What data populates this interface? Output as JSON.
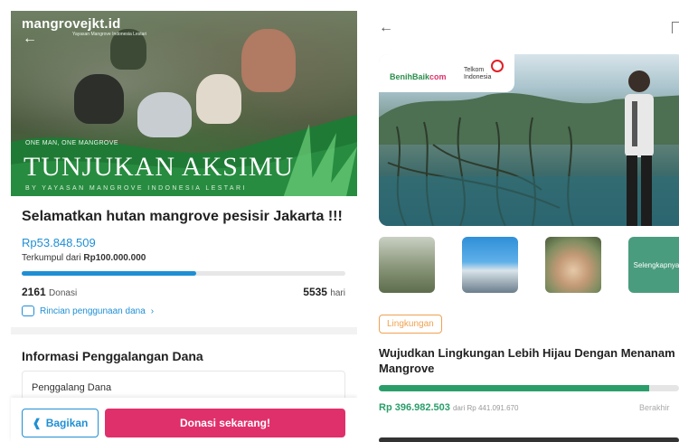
{
  "left": {
    "brand": "mangrovejkt.id",
    "brand_sub": "Yayasan Mangrove Indonesia Lestari",
    "hero_tagline": "ONE MAN, ONE MANGROVE",
    "hero_headline": "TUNJUKAN AKSIMU",
    "hero_byline": "BY YAYASAN MANGROVE INDONESIA LESTARI",
    "title": "Selamatkan hutan mangrove pesisir Jakarta !!!",
    "amount_raised": "Rp53.848.509",
    "collected_prefix": "Terkumpul dari",
    "collected_target": "Rp100.000.000",
    "progress_fraction": 0.54,
    "donations_count": "2161",
    "donations_unit": "Donasi",
    "days_count": "5535",
    "days_unit": "hari",
    "fund_details_link": "Rincian penggunaan dana",
    "info_heading": "Informasi Penggalangan Dana",
    "fundraiser_label": "Penggalang Dana",
    "share_button": "Bagikan",
    "donate_button": "Donasi sekarang!",
    "colors": {
      "accent": "#1f8fd4",
      "donate": "#e0306b"
    }
  },
  "right": {
    "logo_benihbaik_1": "BenihBaik",
    "logo_benihbaik_2": "com",
    "logo_telkom_1": "Telkom",
    "logo_telkom_2": "Indonesia",
    "more_label": "Selengkapnya",
    "category_chip": "Lingkungan",
    "title": "Wujudkan Lingkungan Lebih Hijau Dengan Menanam Mangrove",
    "amount_raised": "Rp 396.982.503",
    "amount_from": "dari Rp 441.091.670",
    "ends_label": "Berakhir",
    "progress_fraction": 0.9,
    "colors": {
      "accent": "#2a9e6a",
      "chip": "#f0a150"
    }
  }
}
